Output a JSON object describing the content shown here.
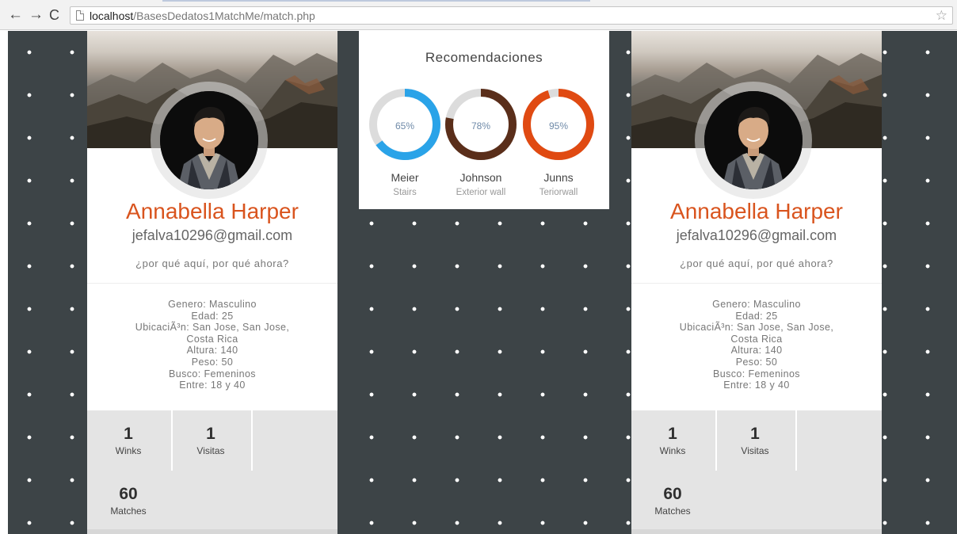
{
  "browser": {
    "back_icon": "arrow-left-icon",
    "forward_icon": "arrow-right-icon",
    "reload_icon": "reload-icon",
    "url_host": "localhost",
    "url_path": "/BasesDedatos1MatchMe/match.php",
    "bookmark_icon": "star-icon"
  },
  "profile": {
    "name": "Annabella Harper",
    "email": "jefalva10296@gmail.com",
    "tagline": "¿por qué aquí, por qué ahora?",
    "details": [
      "Genero: Masculino",
      "Edad: 25",
      "UbicaciÃ³n: San Jose, San Jose,",
      "Costa Rica",
      "Altura: 140",
      "Peso: 50",
      "Busco: Femeninos",
      "Entre: 18 y 40"
    ],
    "stats": {
      "winks_value": "1",
      "winks_label": "Winks",
      "visitas_value": "1",
      "visitas_label": "Visitas",
      "matches_value": "60",
      "matches_label": "Matches"
    }
  },
  "recommendations": {
    "title": "Recomendaciones",
    "items": [
      {
        "percent_label": "65%",
        "percent": 0.65,
        "name": "Meier",
        "subtitle": "Stairs",
        "color": "#2aa3e8"
      },
      {
        "percent_label": "78%",
        "percent": 0.78,
        "name": "Johnson",
        "subtitle": "Exterior wall",
        "color": "#5a2e1a"
      },
      {
        "percent_label": "95%",
        "percent": 0.95,
        "name": "Junns",
        "subtitle": "Teriorwall",
        "color": "#e04a12"
      }
    ]
  }
}
